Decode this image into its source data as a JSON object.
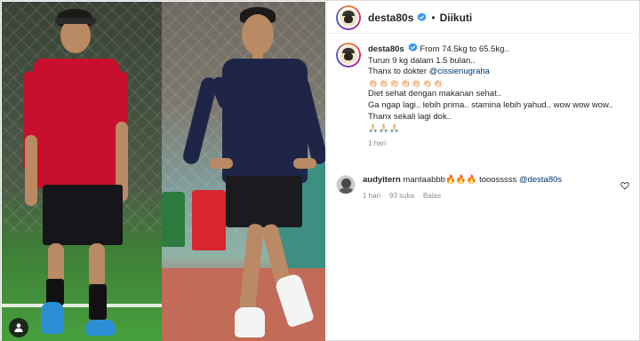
{
  "post": {
    "author": "desta80s",
    "follow_status": "Diikuti",
    "separator": "•"
  },
  "caption": {
    "author": "desta80s",
    "line1": "From 74.5kg to 65.5kg..",
    "line2": "Turun 9 kg dalam 1.5 bulan..",
    "line3_prefix": "Thanx to dokter",
    "line3_mention": "@cissienugraha",
    "line4_emojis": "👏🏻👏🏻👏🏻👏🏻👏🏻👏🏻👏🏻",
    "line5": "Diet sehat dengan makanan sehat..",
    "line6": "Ga ngap lagi.. lebih prima.. stamina lebih yahud.. wow wow wow..",
    "line7": "Thanx sekali lagi dok..",
    "line8_emojis": "🙏🏻🙏🏻🙏🏻",
    "time": "1 hari"
  },
  "comment": {
    "author": "audyitern",
    "text_prefix": "mantaabbb🔥🔥🔥 tooosssss",
    "mention": "@desta80s",
    "time": "1 hari",
    "likes": "93 suka",
    "reply": "Balas"
  },
  "colors": {
    "verified": "#3897f0",
    "mention": "#00376b",
    "muted": "#8e8e8e"
  },
  "icons": {
    "verified": "verified-badge-icon",
    "like": "heart-outline-icon",
    "user_tag": "person-tag-icon"
  }
}
